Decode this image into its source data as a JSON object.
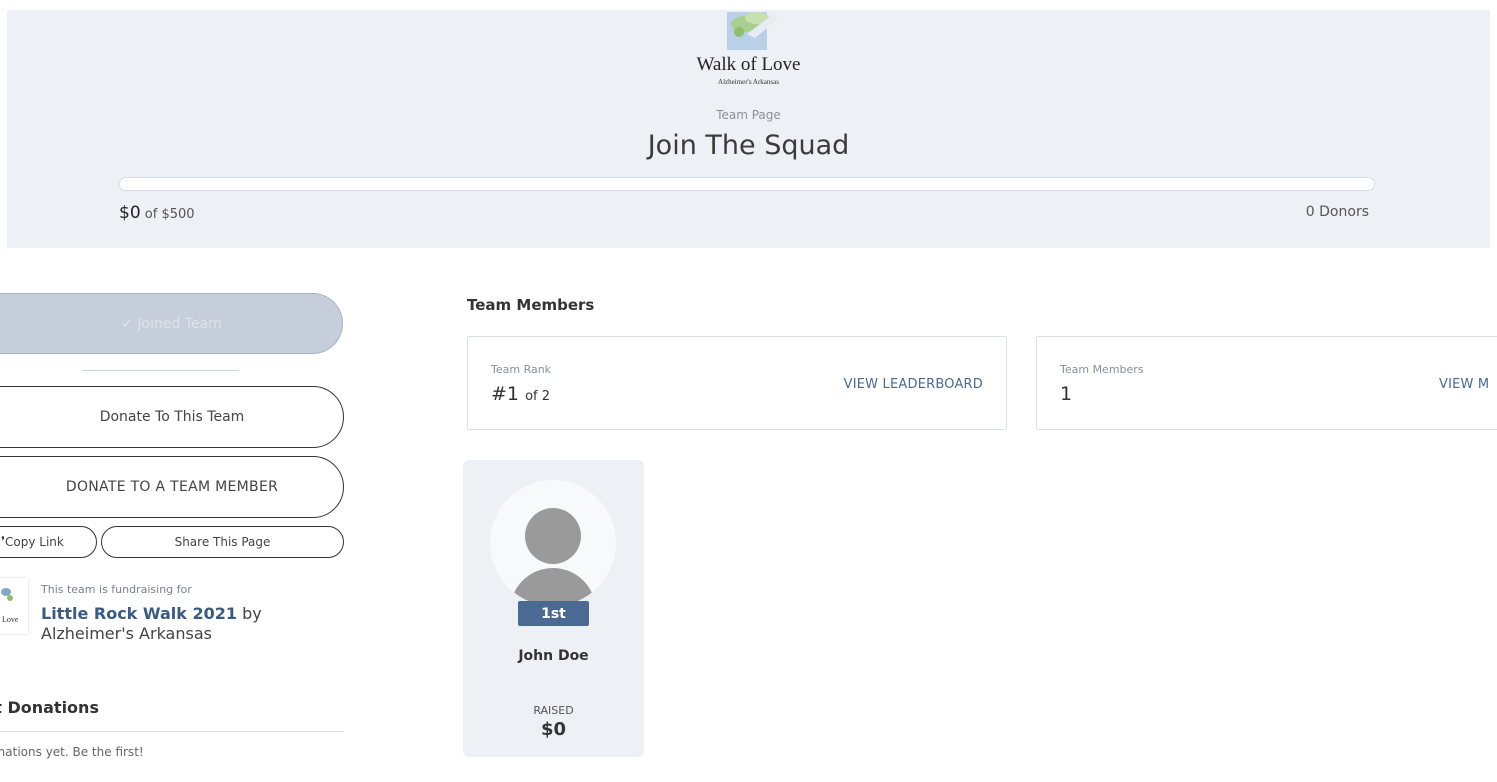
{
  "brand": {
    "name": "Walk of Love",
    "subtitle": "Alzheimer's Arkansas",
    "accent": "#4a6a93"
  },
  "header": {
    "page_type": "Team Page",
    "title": "Join The Squad",
    "progress": {
      "raised": "$0",
      "of_label": "of $500",
      "fraction": 0
    },
    "donors": "0 Donors"
  },
  "sidebar": {
    "joined_button": "Joined Team",
    "donate_team_button": "Donate To This Team",
    "donate_member_button": "DONATE TO A TEAM MEMBER",
    "copy_link_button": "Copy Link",
    "share_button": "Share This Page",
    "fundraising": {
      "intro": "This team is fundraising for",
      "event_name": "Little Rock Walk 2021",
      "by_label": "by",
      "org_name": "Alzheimer's Arkansas",
      "thumb_text": "Love"
    },
    "recent_donations": {
      "title": "ent Donations",
      "empty_text": "lonations yet. Be the first!"
    }
  },
  "main": {
    "heading": "Team Members",
    "rank_card": {
      "label": "Team Rank",
      "value": "#1",
      "of_text": "of 2",
      "link": "VIEW LEADERBOARD"
    },
    "members_card": {
      "label": "Team Members",
      "value": "1",
      "link": "VIEW M"
    },
    "members": [
      {
        "rank": "1st",
        "name": "John Doe",
        "raised_label": "RAISED",
        "raised": "$0"
      }
    ]
  }
}
